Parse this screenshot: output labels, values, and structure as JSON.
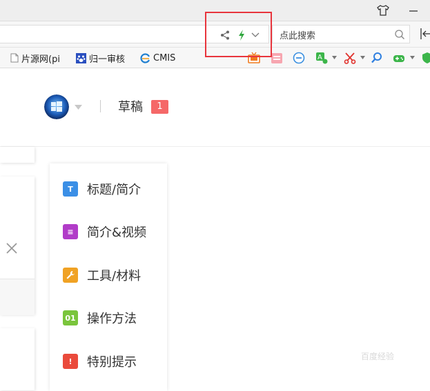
{
  "search": {
    "placeholder": "点此搜索"
  },
  "bookmarks": [
    {
      "label": "片源网(pi",
      "icon": "page-icon"
    },
    {
      "label": "归一审核",
      "icon": "paw-icon"
    },
    {
      "label": "CMIS",
      "icon": "browser-logo-icon"
    }
  ],
  "extensions": [
    "tv-icon",
    "calendar-icon",
    "minus-circle-icon",
    "translate-icon",
    "scissors-icon",
    "magnifier-icon",
    "gamepad-icon",
    "shield-icon"
  ],
  "header": {
    "draft_label": "草稿",
    "draft_count": "1"
  },
  "toc": [
    {
      "label": "标题/简介",
      "icon_text": "T",
      "color": "#3b8fe6"
    },
    {
      "label": "简介&视频",
      "icon_text": "≡",
      "color": "#b13cc8"
    },
    {
      "label": "工具/材料",
      "icon_text": "",
      "color": "#f0a224"
    },
    {
      "label": "操作方法",
      "icon_text": "01",
      "color": "#7ac53c"
    },
    {
      "label": "特别提示",
      "icon_text": "!",
      "color": "#ea4a3b"
    }
  ],
  "watermark": "百度经验",
  "colors": {
    "highlight": "#e8343c",
    "badge": "#f56868",
    "bolt": "#2fa63d"
  }
}
